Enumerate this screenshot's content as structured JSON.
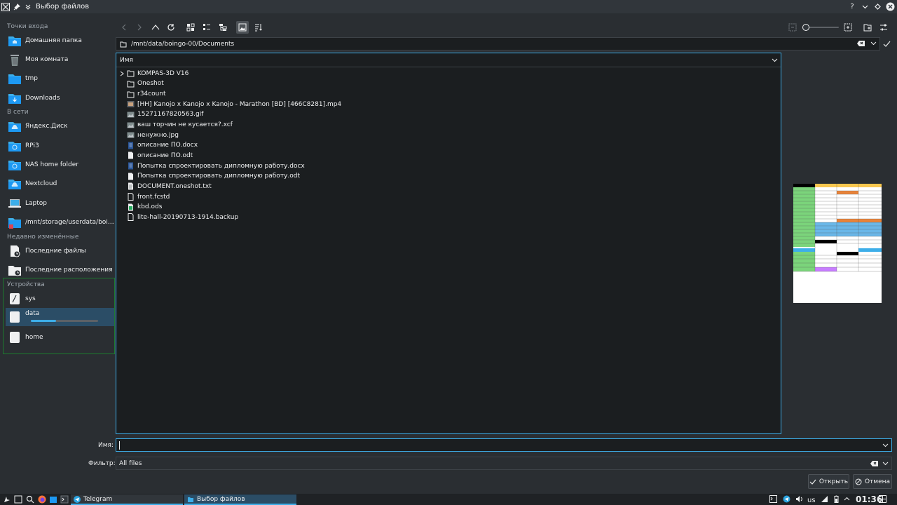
{
  "window": {
    "title": "Выбор файлов"
  },
  "sidebar": {
    "sections": {
      "entry_points": "Точки входа",
      "network": "В сети",
      "recent": "Недавно изменённые",
      "devices": "Устройства"
    },
    "places": [
      {
        "label": "Домашняя папка",
        "icon": "home-folder-icon"
      },
      {
        "label": "Моя комната",
        "icon": "trash-icon"
      },
      {
        "label": "tmp",
        "icon": "folder-icon"
      },
      {
        "label": "Downloads",
        "icon": "downloads-folder-icon"
      }
    ],
    "network": [
      {
        "label": "Яндекс.Диск",
        "icon": "cloud-folder-icon"
      },
      {
        "label": "RPi3",
        "icon": "network-folder-icon"
      },
      {
        "label": "NAS home folder",
        "icon": "network-folder-icon"
      },
      {
        "label": "Nextcloud",
        "icon": "cloud-folder-icon"
      },
      {
        "label": "Laptop",
        "icon": "laptop-icon"
      },
      {
        "label": "/mnt/storage/userdata/boing...",
        "icon": "network-folder-icon"
      }
    ],
    "recent": [
      {
        "label": "Последние файлы",
        "icon": "recent-files-icon"
      },
      {
        "label": "Последние расположения",
        "icon": "recent-locations-icon"
      }
    ],
    "devices": [
      {
        "label": "sys",
        "icon": "drive-icon"
      },
      {
        "label": "data",
        "icon": "drive-icon",
        "usage_fraction": 0.38
      },
      {
        "label": "home",
        "icon": "drive-icon"
      }
    ]
  },
  "location": {
    "path": "/mnt/data/boingo-00/Documents"
  },
  "fileview": {
    "column_header": "Имя",
    "files": [
      {
        "name": "KOMPAS-3D V16",
        "type": "folder",
        "expandable": true
      },
      {
        "name": "Oneshot",
        "type": "folder"
      },
      {
        "name": "r34count",
        "type": "folder"
      },
      {
        "name": "[HH] Kanojo x Kanojo x Kanojo - Marathon [BD] [466C8281].mp4",
        "type": "video"
      },
      {
        "name": "15271167820563.gif",
        "type": "image"
      },
      {
        "name": "ваш торчин не кусается?.xcf",
        "type": "image"
      },
      {
        "name": "ненужно.jpg",
        "type": "image"
      },
      {
        "name": "описание ПО.docx",
        "type": "docx"
      },
      {
        "name": "описание ПО.odt",
        "type": "document"
      },
      {
        "name": "Попытка спроектировать дипломную работу.docx",
        "type": "docx"
      },
      {
        "name": "Попытка спроектировать дипломную работу.odt",
        "type": "document"
      },
      {
        "name": "DOCUMENT.oneshot.txt",
        "type": "text"
      },
      {
        "name": "front.fcstd",
        "type": "file"
      },
      {
        "name": "kbd.ods",
        "type": "spreadsheet"
      },
      {
        "name": "lite-hall-20190713-1914.backup",
        "type": "file"
      }
    ]
  },
  "bottom": {
    "name_label": "Имя:",
    "name_value": "",
    "filter_label": "Фильтр:",
    "filter_value": "All files",
    "open_button": "Открыть",
    "cancel_button": "Отмена"
  },
  "taskbar": {
    "tasks": [
      {
        "label": "Telegram"
      },
      {
        "label": "Выбор файлов"
      }
    ],
    "keyboard_layout": "us",
    "clock": "01:36"
  },
  "colors": {
    "accent": "#3daee9",
    "window_bg": "#2a2e32",
    "view_bg": "#1b1e20",
    "selection": "#2b4d66",
    "devices_frame": "#1e7a2e"
  }
}
